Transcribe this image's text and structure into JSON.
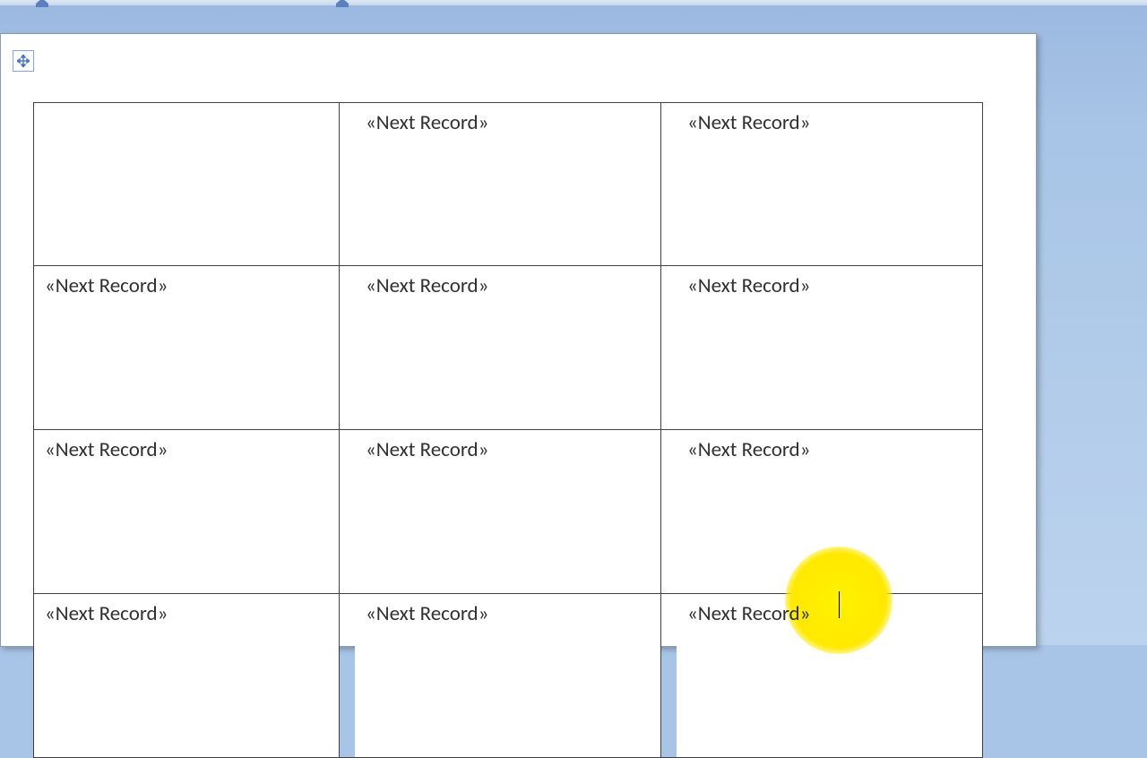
{
  "merge_field_text": "«Next Record»",
  "labels": {
    "rows": 4,
    "cols": 3,
    "cells": [
      [
        "",
        "«Next Record»",
        "«Next Record»"
      ],
      [
        "«Next Record»",
        "«Next Record»",
        "«Next Record»"
      ],
      [
        "«Next Record»",
        "«Next Record»",
        "«Next Record»"
      ],
      [
        "«Next Record»",
        "«Next Record»",
        "«Next Record»"
      ]
    ]
  },
  "cursor": {
    "row": 3,
    "col": 2
  }
}
